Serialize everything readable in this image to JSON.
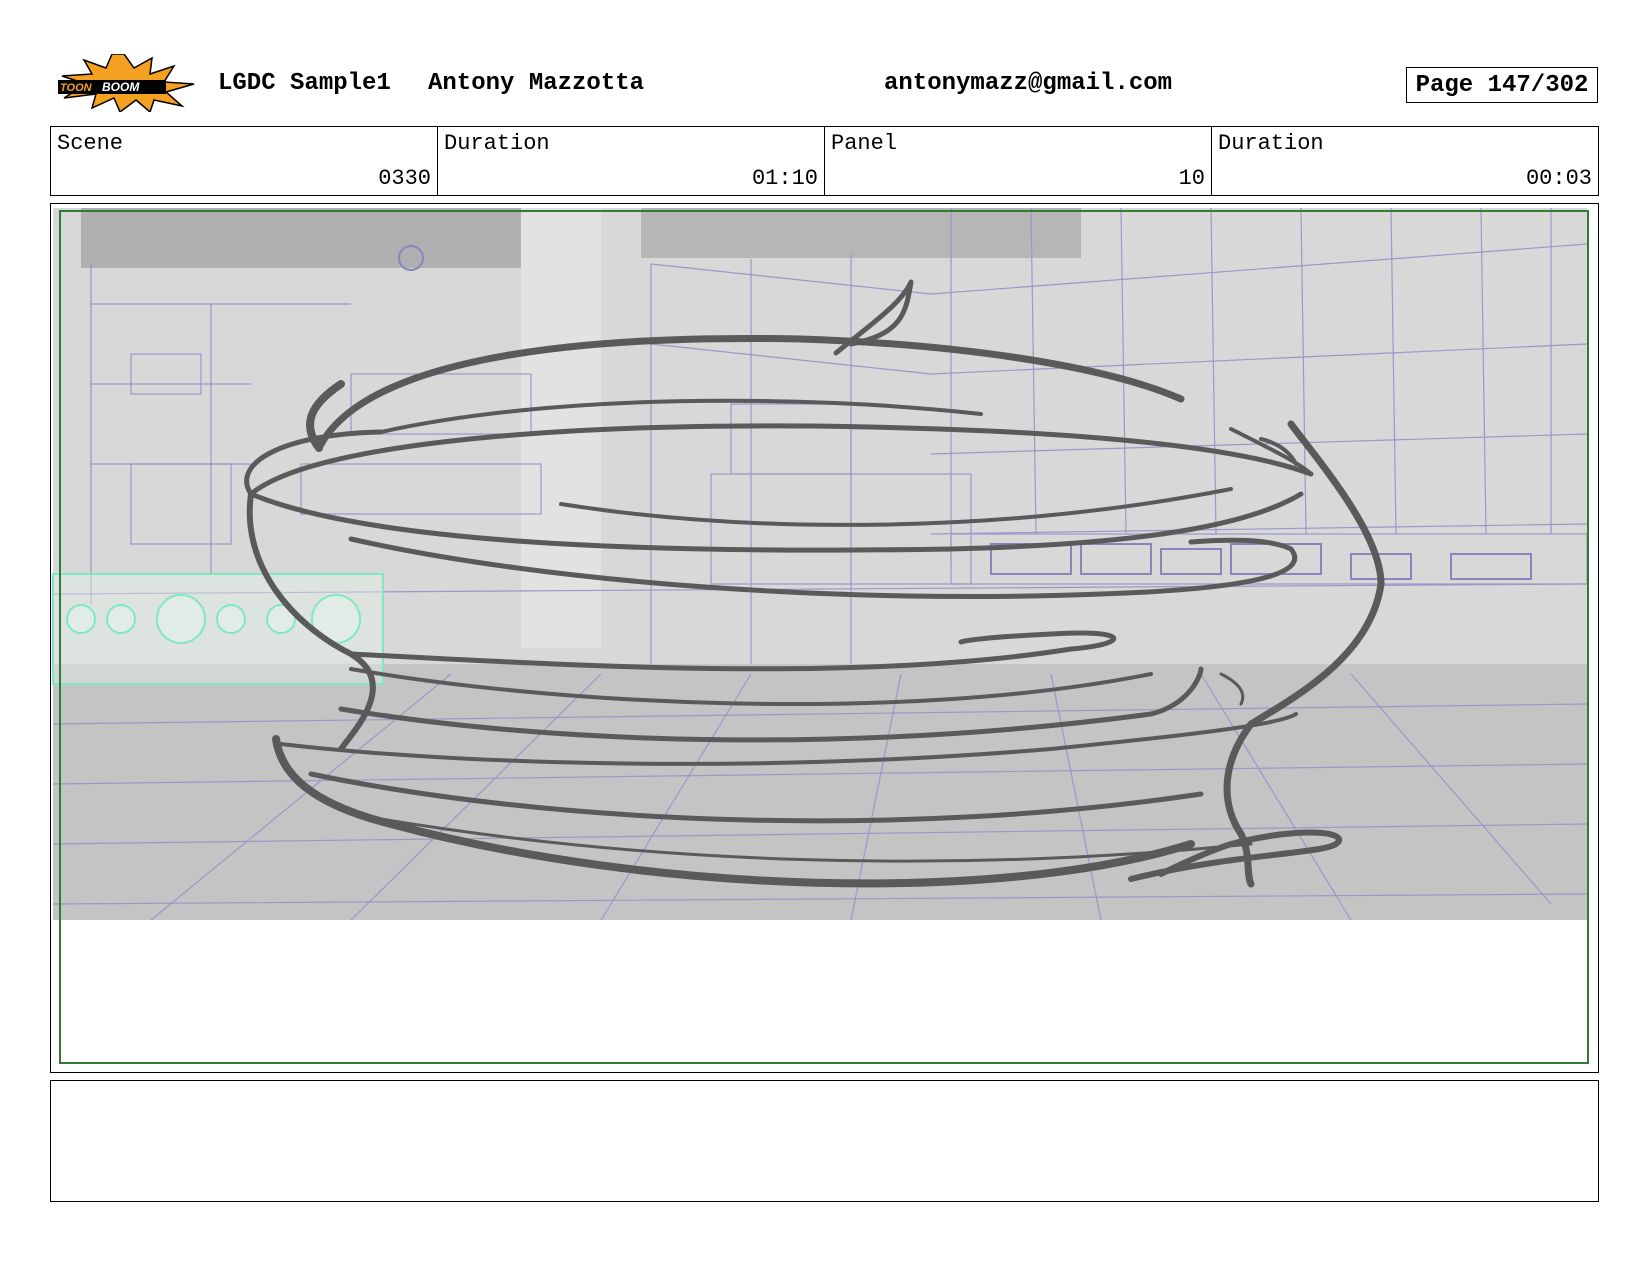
{
  "header": {
    "logo_icon": "toonboom-logo-icon",
    "logo_text_left": "TOON",
    "logo_text_right": "BOOM",
    "project": "LGDC Sample1",
    "author": "Antony Mazzotta",
    "email": "antonymazz@gmail.com",
    "page": "Page 147/302"
  },
  "info": {
    "scene_label": "Scene",
    "scene_value": "0330",
    "duration_label": "Duration",
    "duration_value": "01:10",
    "panel_label": "Panel",
    "panel_value": "10",
    "panel_duration_label": "Duration",
    "panel_duration_value": "00:03"
  },
  "panel": {
    "image_icon": "storyboard-sketch-kitchen-tornado",
    "safe_frame_color": "#2e7d32",
    "sketch_color": "#5a5a5a",
    "wireframe_color": "#9a98c8",
    "highlight_color": "#7fe8c0"
  },
  "notes": {
    "text": ""
  }
}
